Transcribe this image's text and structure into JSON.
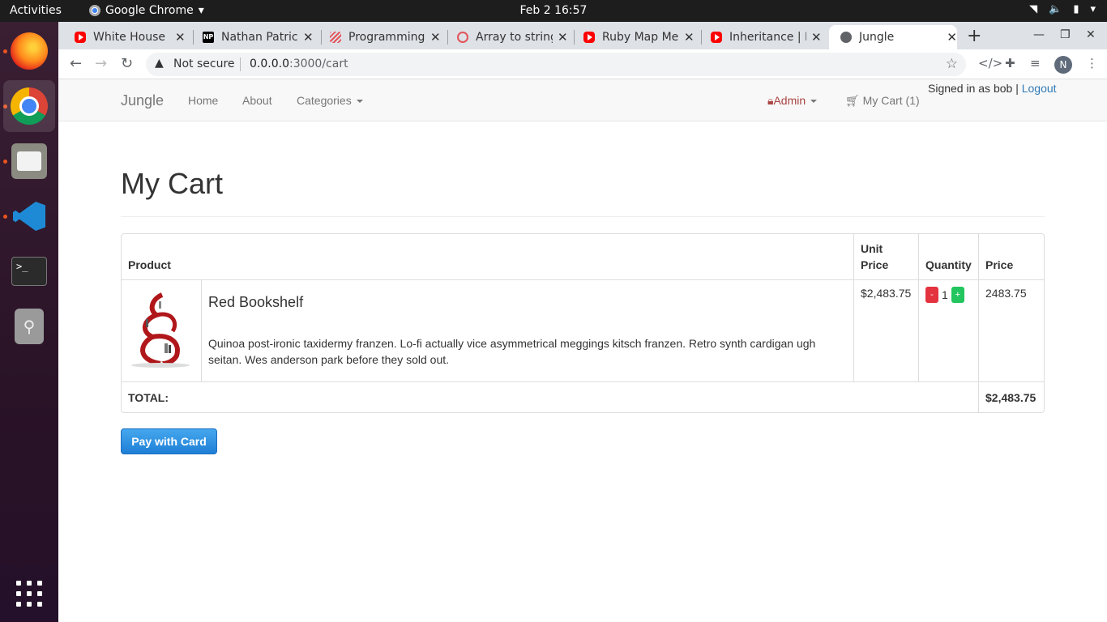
{
  "os": {
    "activities": "Activities",
    "app_name": "Google Chrome",
    "clock": "Feb 2  16:57"
  },
  "browser": {
    "tabs": [
      {
        "title": "White House",
        "icon": "youtube-icon"
      },
      {
        "title": "Nathan Patric",
        "icon": "np-icon"
      },
      {
        "title": "Programming",
        "icon": "programming-icon"
      },
      {
        "title": "Array to string",
        "icon": "array-icon"
      },
      {
        "title": "Ruby Map Me",
        "icon": "youtube-icon"
      },
      {
        "title": "Inheritance | R",
        "icon": "youtube-icon"
      },
      {
        "title": "Jungle",
        "icon": "globe-icon",
        "active": true
      }
    ],
    "not_secure": "Not secure",
    "url_host": "0.0.0.0",
    "url_rest": ":3000/cart",
    "profile_initial": "N"
  },
  "navbar": {
    "brand": "Jungle",
    "home": "Home",
    "about": "About",
    "categories": "Categories",
    "admin": "Admin",
    "cart": "My Cart (1)",
    "signed_in": "Signed in as bob | ",
    "logout": "Logout"
  },
  "page": {
    "title": "My Cart",
    "table": {
      "headers": {
        "product": "Product",
        "unit_price_1": "Unit",
        "unit_price_2": "Price",
        "quantity": "Quantity",
        "price": "Price"
      },
      "rows": [
        {
          "name": "Red Bookshelf",
          "description": "Quinoa post-ironic taxidermy franzen. Lo-fi actually vice asymmetrical meggings kitsch franzen. Retro synth cardigan ugh seitan. Wes anderson park before they sold out.",
          "unit_price": "$2,483.75",
          "quantity": "1",
          "minus": "-",
          "plus": "+",
          "price": "2483.75"
        }
      ],
      "total_label": "TOTAL:",
      "total_value": "$2,483.75"
    },
    "pay_button": "Pay with Card"
  },
  "colors": {
    "admin": "#a94442",
    "link": "#337ab7",
    "minus": "#e3333f",
    "plus": "#22c55e",
    "pay": "#1f7fd6"
  }
}
